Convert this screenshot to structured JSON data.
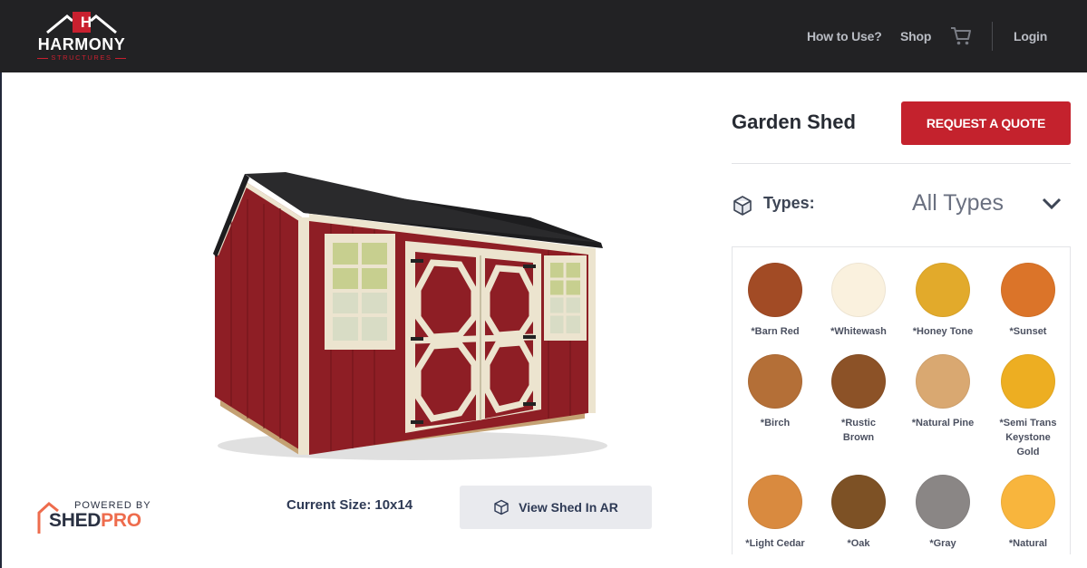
{
  "brand": {
    "name": "HARMONY",
    "sub": "STRUCTURES",
    "mark_letter": "H"
  },
  "nav": {
    "how_to_use": "How to Use?",
    "shop": "Shop",
    "login": "Login"
  },
  "viewer": {
    "current_size_label": "Current Size:",
    "current_size_value": "10x14",
    "ar_button": "View Shed In AR"
  },
  "powered": {
    "by": "POWERED BY",
    "name_shed": "SHED",
    "name_pro": "PRO"
  },
  "product": {
    "title": "Garden Shed",
    "quote_button": "REQUEST A QUOTE"
  },
  "types": {
    "label": "Types:",
    "selected": "All Types"
  },
  "swatches": [
    {
      "name": "*Barn Red",
      "color": "#a24b25"
    },
    {
      "name": "*Whitewash",
      "color": "#faf1de"
    },
    {
      "name": "*Honey Tone",
      "color": "#e2aa2b"
    },
    {
      "name": "*Sunset",
      "color": "#db7429"
    },
    {
      "name": "*Birch",
      "color": "#b46f37"
    },
    {
      "name": "*Rustic Brown",
      "color": "#8c5227"
    },
    {
      "name": "*Natural Pine",
      "color": "#d9a871"
    },
    {
      "name": "*Semi Trans Keystone Gold",
      "color": "#edae22"
    },
    {
      "name": "*Light Cedar",
      "color": "#d98a3f"
    },
    {
      "name": "*Oak",
      "color": "#7d5125"
    },
    {
      "name": "*Gray",
      "color": "#8a8685"
    },
    {
      "name": "*Natural",
      "color": "#f8b53d"
    }
  ],
  "colors": {
    "header_bg": "#222224",
    "accent_red": "#c4222d",
    "nav_text": "#b9bcc3",
    "shed_siding": "#8e1e25",
    "shed_trim": "#ece4cf",
    "roof": "#1d1d1f"
  },
  "icons": {
    "cart": "cart-icon",
    "types": "cube-icon",
    "chevron": "chevron-down-icon",
    "ar": "cube-icon"
  }
}
